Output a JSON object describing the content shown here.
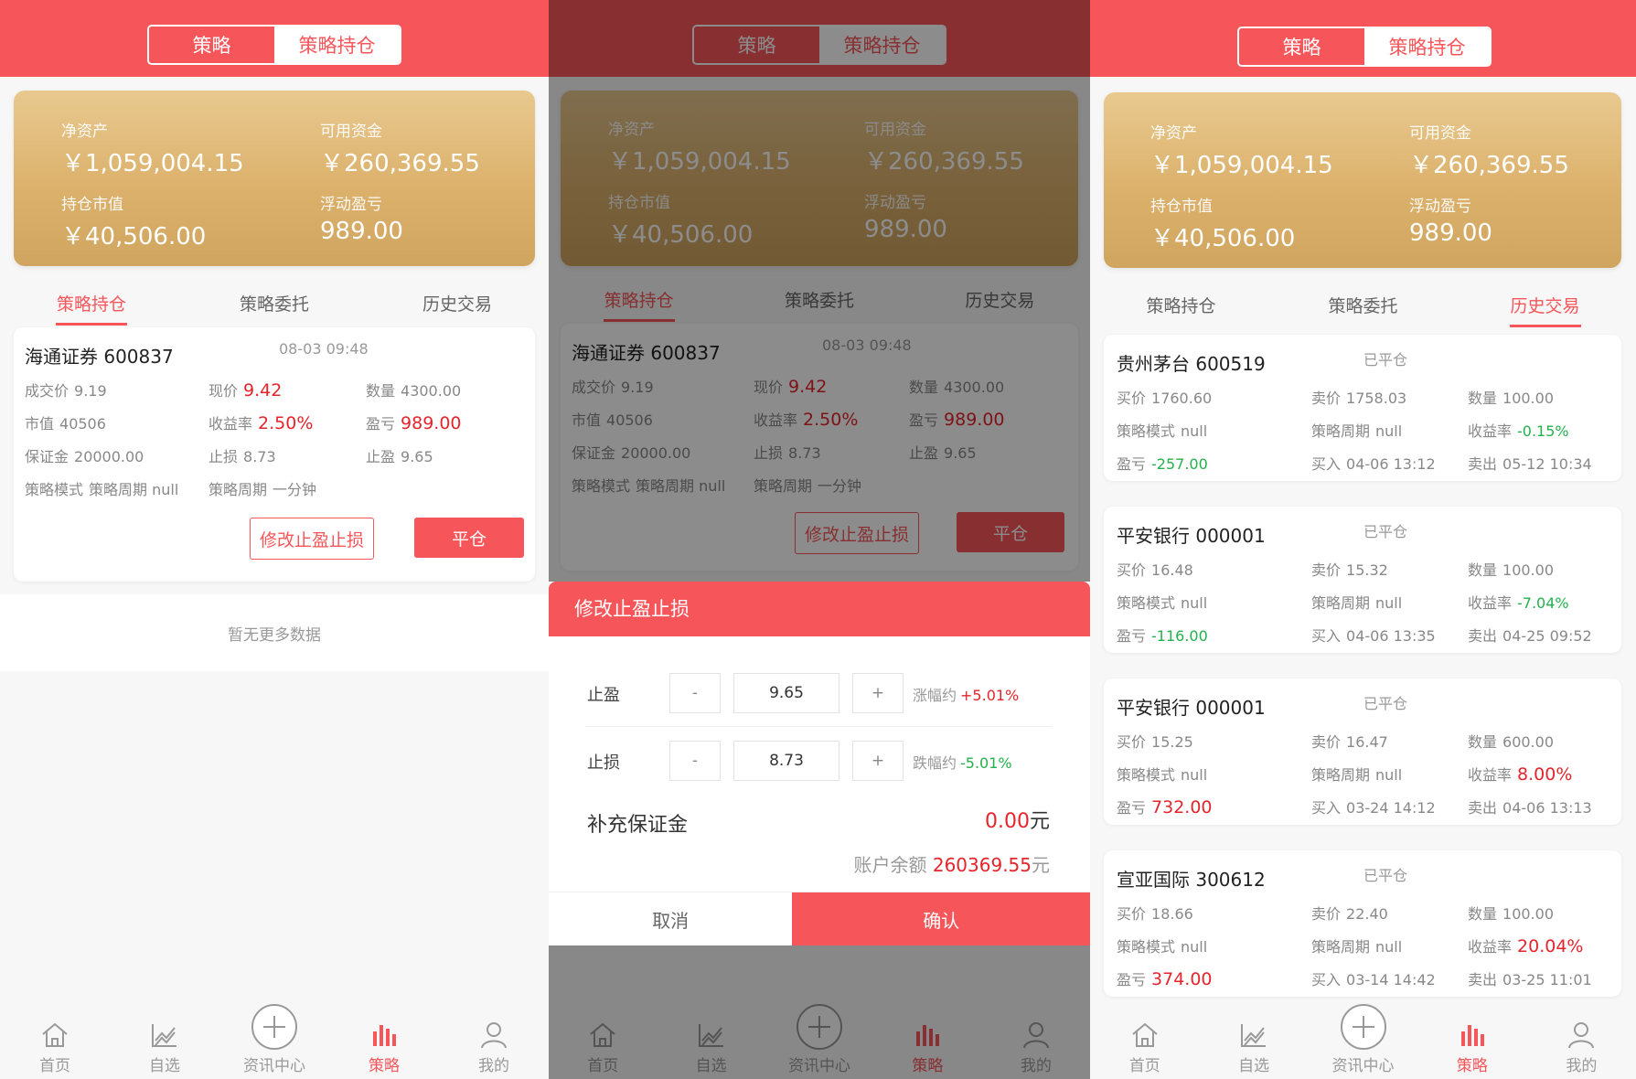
{
  "colors": {
    "accent": "#f6565a",
    "gold": "#dcb16c",
    "up": "#e5242b",
    "down": "#22b14c"
  },
  "segment": {
    "strategy": "策略",
    "holdings": "策略持仓"
  },
  "account": {
    "net_label": "净资产",
    "net_value": "￥1,059,004.15",
    "avail_label": "可用资金",
    "avail_value": "￥260,369.55",
    "mv_label": "持仓市值",
    "mv_value": "￥40,506.00",
    "pl_label": "浮动盈亏",
    "pl_value": "989.00"
  },
  "tabs": {
    "holdings": "策略持仓",
    "orders": "策略委托",
    "history": "历史交易"
  },
  "position": {
    "name": "海通证券 600837",
    "time": "08-03 09:48",
    "fields": [
      {
        "label": "成交价",
        "value": "9.19",
        "tone": ""
      },
      {
        "label": "现价",
        "value": "9.42",
        "tone": "red"
      },
      {
        "label": "数量",
        "value": "4300.00",
        "tone": ""
      },
      {
        "label": "市值",
        "value": "40506",
        "tone": ""
      },
      {
        "label": "收益率",
        "value": "2.50%",
        "tone": "red"
      },
      {
        "label": "盈亏",
        "value": "989.00",
        "tone": "red"
      },
      {
        "label": "保证金",
        "value": "20000.00",
        "tone": ""
      },
      {
        "label": "止损",
        "value": "8.73",
        "tone": ""
      },
      {
        "label": "止盈",
        "value": "9.65",
        "tone": ""
      },
      {
        "label": "策略模式",
        "value": "策略周期 null",
        "tone": ""
      },
      {
        "label": "策略周期",
        "value": "一分钟",
        "tone": ""
      }
    ],
    "modify_label": "修改止盈止损",
    "close_label": "平仓"
  },
  "no_more": "暂无更多数据",
  "modal": {
    "title": "修改止盈止损",
    "tp_label": "止盈",
    "tp_value": "9.65",
    "tp_range_label": "涨幅约",
    "tp_range": "+5.01%",
    "sl_label": "止损",
    "sl_value": "8.73",
    "sl_range_label": "跌幅约",
    "sl_range": "-5.01%",
    "minus": "-",
    "plus": "+",
    "margin_label": "补充保证金",
    "margin_value": "0.00",
    "yuan": "元",
    "balance_label": "账户余额",
    "balance_value": "260369.55",
    "cancel": "取消",
    "confirm": "确认"
  },
  "history": [
    {
      "name": "贵州茅台 600519",
      "status": "已平仓",
      "buy_price": "1760.60",
      "sell_price": "1758.03",
      "qty": "100.00",
      "mode": "null",
      "period": "null",
      "rate": "-0.15%",
      "rate_tone": "green",
      "pl": "-257.00",
      "pl_tone": "green",
      "buy_time": "04-06 13:12",
      "sell_time": "05-12 10:34"
    },
    {
      "name": "平安银行 000001",
      "status": "已平仓",
      "buy_price": "16.48",
      "sell_price": "15.32",
      "qty": "100.00",
      "mode": "null",
      "period": "null",
      "rate": "-7.04%",
      "rate_tone": "green",
      "pl": "-116.00",
      "pl_tone": "green",
      "buy_time": "04-06 13:35",
      "sell_time": "04-25 09:52"
    },
    {
      "name": "平安银行 000001",
      "status": "已平仓",
      "buy_price": "15.25",
      "sell_price": "16.47",
      "qty": "600.00",
      "mode": "null",
      "period": "null",
      "rate": "8.00%",
      "rate_tone": "red",
      "pl": "732.00",
      "pl_tone": "red",
      "buy_time": "03-24 14:12",
      "sell_time": "04-06 13:13"
    },
    {
      "name": "宣亚国际 300612",
      "status": "已平仓",
      "buy_price": "18.66",
      "sell_price": "22.40",
      "qty": "100.00",
      "mode": "null",
      "period": "null",
      "rate": "20.04%",
      "rate_tone": "red",
      "pl": "374.00",
      "pl_tone": "red",
      "buy_time": "03-14 14:42",
      "sell_time": "03-25 11:01"
    }
  ],
  "history_labels": {
    "buy_price": "买价",
    "sell_price": "卖价",
    "qty": "数量",
    "mode": "策略模式",
    "period": "策略周期",
    "rate": "收益率",
    "pl": "盈亏",
    "buy_time": "买入",
    "sell_time": "卖出"
  },
  "nav": [
    {
      "label": "首页",
      "icon": "home-icon"
    },
    {
      "label": "自选",
      "icon": "chart-icon"
    },
    {
      "label": "资讯中心",
      "icon": "plus-circle-icon"
    },
    {
      "label": "策略",
      "icon": "strategy-bars-icon"
    },
    {
      "label": "我的",
      "icon": "user-icon"
    }
  ]
}
